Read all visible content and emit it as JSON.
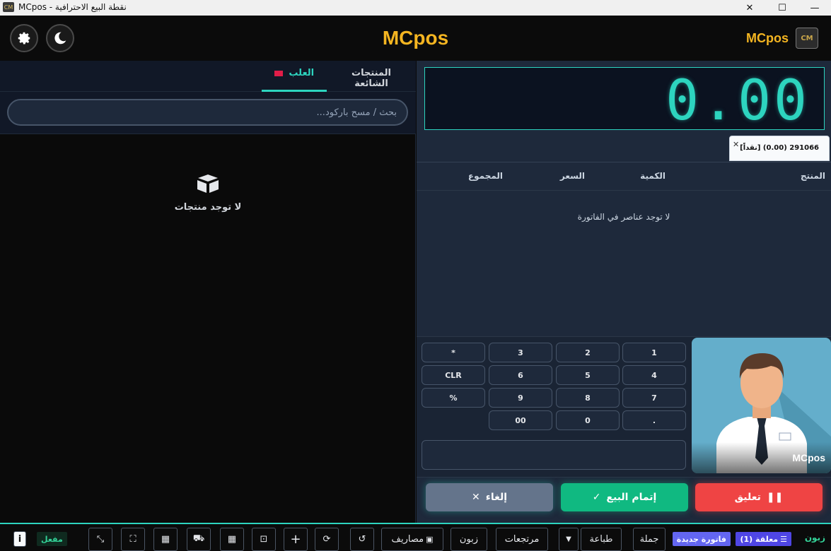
{
  "window": {
    "title": "MCpos - نقطة البيع الاحترافية",
    "minimize": "—",
    "maximize": "☐",
    "close": "✕"
  },
  "header": {
    "title": "MCpos",
    "brand_name": "MCpos",
    "logo_text": "CM"
  },
  "products": {
    "tabs": [
      {
        "label": "العلب"
      },
      {
        "label": "المنتجات الشائعة"
      }
    ],
    "search_placeholder": "بحث / مسح باركود...",
    "empty_text": "لا توجد منتجات"
  },
  "display": {
    "total": "0.00"
  },
  "invoice": {
    "tab_label": "291066 (0.00) [نقداً]",
    "columns": {
      "product": "المنتج",
      "qty": "الكمية",
      "price": "السعر",
      "total": "المجموع"
    },
    "empty_text": "لا توجد عناصر في الفاتورة"
  },
  "keypad": {
    "keys": [
      "1",
      "2",
      "3",
      "*",
      "4",
      "5",
      "6",
      "CLR",
      "7",
      "8",
      "9",
      "%",
      ".",
      "0",
      "00"
    ]
  },
  "cashier": {
    "name": "MCpos"
  },
  "actions": {
    "suspend": "تعليق",
    "complete": "إتمام البيع",
    "cancel": "إلغاء"
  },
  "footer": {
    "customer_label": "زبون",
    "suspended_badge": "معلقة (1)",
    "new_invoice_badge": "فاتورة جديدة",
    "wholesale": "جملة",
    "print": "طباعة",
    "returns": "مرتجعات",
    "customer_btn": "زبون",
    "expenses": "مصاريف",
    "status_badge": "مفعل",
    "info": "i"
  },
  "colors": {
    "accent": "#2dd4bf",
    "brand": "#f4b521",
    "danger": "#ef4444",
    "success": "#10b981",
    "neutral": "#64748b",
    "badge_purple": "#6366f1"
  }
}
